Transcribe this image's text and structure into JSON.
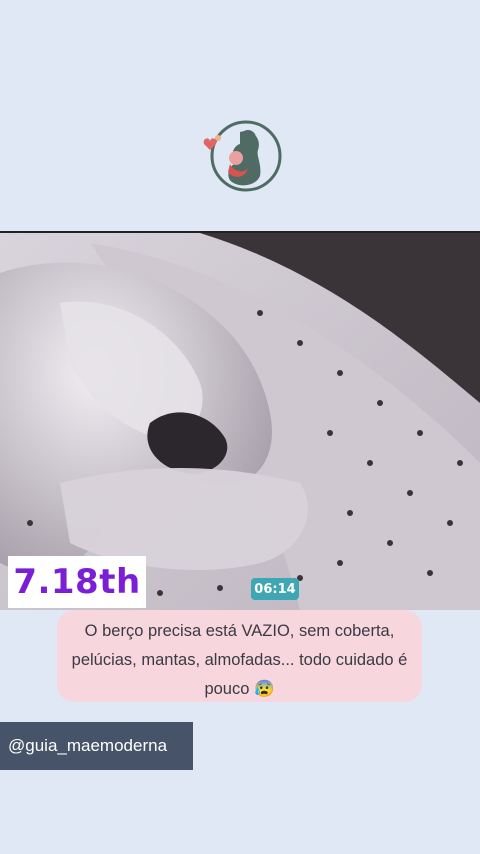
{
  "logo": {
    "icon": "mother-baby-logo-icon"
  },
  "video": {
    "description_icon": "baby-monitor-feed",
    "timestamp": "06:14"
  },
  "date_badge": {
    "text": "7.18th"
  },
  "caption": {
    "text": "O berço precisa está VAZIO, sem coberta, pelúcias, mantas, almofadas... todo cuidado é pouco 😰"
  },
  "handle": {
    "text": "@guia_maemoderna"
  },
  "colors": {
    "background": "#dfe8f4",
    "caption_bg": "#f7d6dd",
    "badge_text": "#7b1fd6",
    "timestamp_bg": "#3fa7b3",
    "handle_bg": "#465368"
  }
}
